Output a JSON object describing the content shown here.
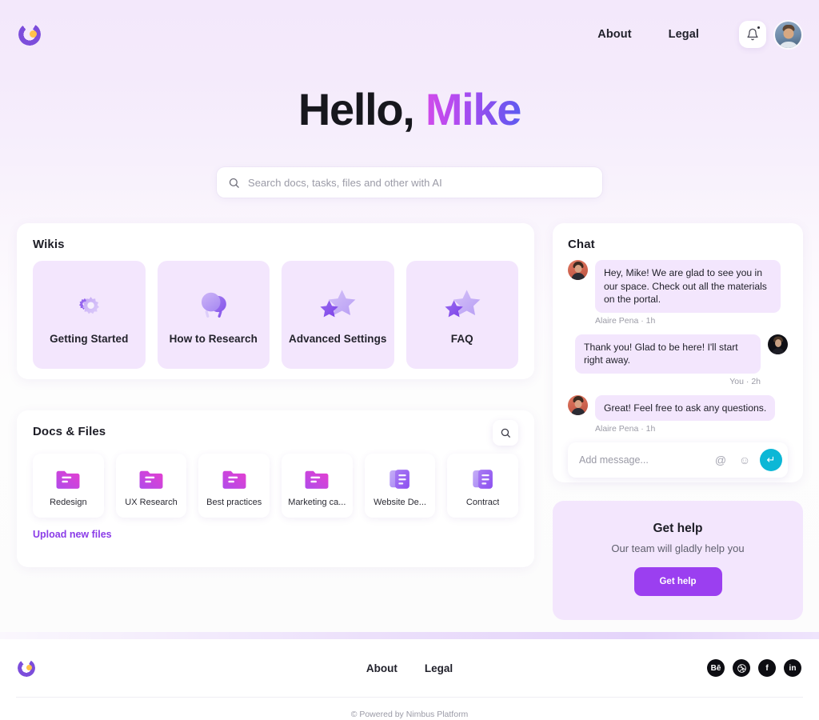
{
  "brand": {
    "logo_icon": "nimbus-c-logo",
    "accent": "#9b3ff0",
    "accent_secondary": "#ffc24b",
    "gradient_start": "#d24bea",
    "gradient_end": "#5c5cf0"
  },
  "header": {
    "nav": [
      {
        "label": "About"
      },
      {
        "label": "Legal"
      }
    ],
    "bell_icon": "bell-icon",
    "has_notification": true,
    "avatar_icon": "user-avatar"
  },
  "hero": {
    "greeting": "Hello,",
    "name": "Mike"
  },
  "search": {
    "icon": "search-icon",
    "placeholder": "Search docs, tasks, files and other with AI",
    "value": ""
  },
  "wikis": {
    "title": "Wikis",
    "items": [
      {
        "label": "Getting Started",
        "icon": "gears-icon"
      },
      {
        "label": "How to Research",
        "icon": "magnifiers-icon"
      },
      {
        "label": "Advanced Settings",
        "icon": "stars-icon"
      },
      {
        "label": "FAQ",
        "icon": "stars-icon"
      }
    ]
  },
  "docs": {
    "title": "Docs & Files",
    "search_icon": "search-icon",
    "items": [
      {
        "label": "Redesign",
        "icon": "folder-icon"
      },
      {
        "label": "UX Research",
        "icon": "folder-icon"
      },
      {
        "label": "Best practices",
        "icon": "folder-icon"
      },
      {
        "label": "Marketing ca...",
        "icon": "folder-icon"
      },
      {
        "label": "Website De...",
        "icon": "document-icon"
      },
      {
        "label": "Contract",
        "icon": "document-icon"
      }
    ],
    "upload_label": "Upload new files"
  },
  "chat": {
    "title": "Chat",
    "messages": [
      {
        "direction": "in",
        "text": "Hey, Mike! We are glad to see you in our space. Check out all the materials on the portal.",
        "meta": "Alaire Pena · 1h"
      },
      {
        "direction": "out",
        "text": "Thank you! Glad to be here! I'll start right away.",
        "meta": "You · 2h"
      },
      {
        "direction": "in",
        "text": "Great! Feel free to ask any questions.",
        "meta": "Alaire Pena · 1h"
      }
    ],
    "input": {
      "placeholder": "Add message...",
      "value": "",
      "mention_icon": "at-icon",
      "emoji_icon": "emoji-icon",
      "send_icon": "enter-arrow-icon",
      "send_color": "#0cb7d6"
    }
  },
  "help": {
    "title": "Get help",
    "subtitle": "Our team will gladly help you",
    "button_label": "Get help"
  },
  "footer": {
    "logo_icon": "nimbus-c-logo",
    "nav": [
      {
        "label": "About"
      },
      {
        "label": "Legal"
      }
    ],
    "socials": [
      {
        "name": "behance",
        "glyph": "Bē"
      },
      {
        "name": "dribbble",
        "glyph": "●"
      },
      {
        "name": "facebook",
        "glyph": "f"
      },
      {
        "name": "linkedin",
        "glyph": "in"
      }
    ],
    "copyright": "© Powered by Nimbus Platform"
  }
}
